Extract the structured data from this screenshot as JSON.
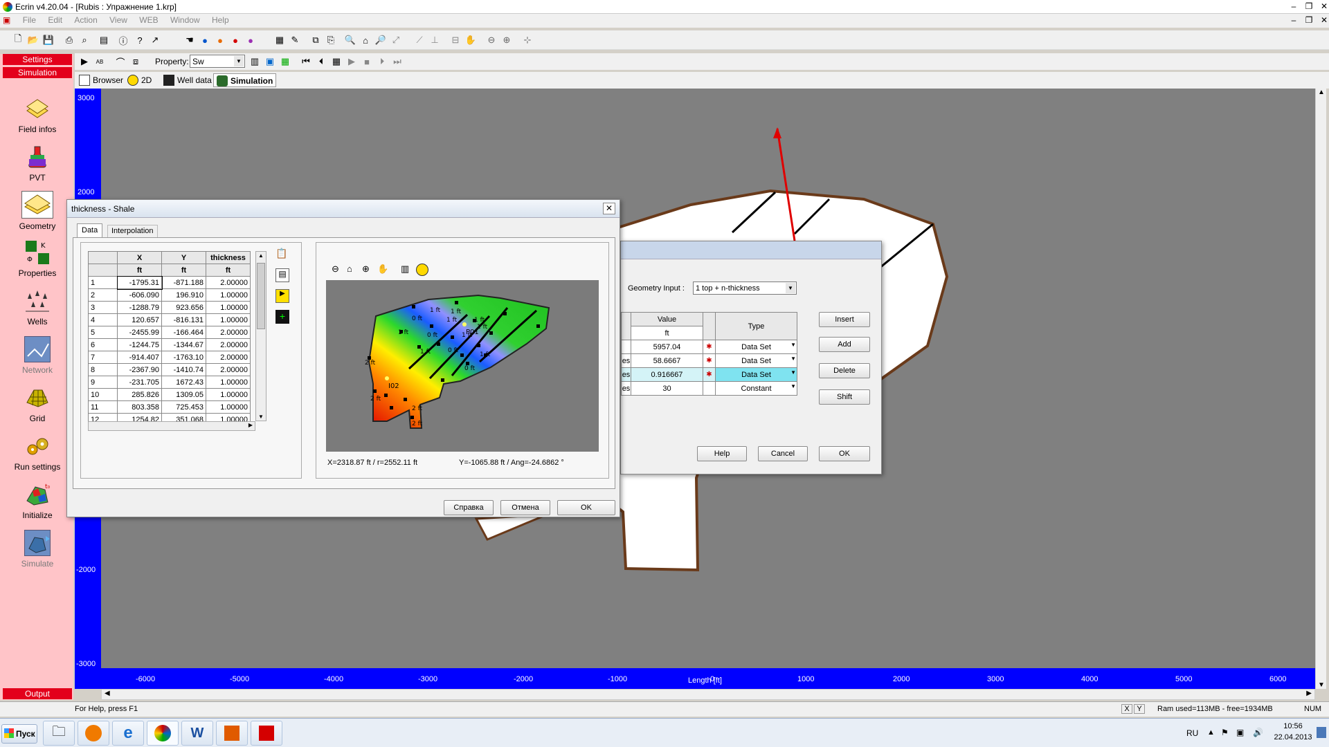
{
  "app": {
    "title": "Ecrin  v4.20.04 - [Rubis : Упражнение 1.krp]",
    "menu": [
      "File",
      "Edit",
      "Action",
      "View",
      "WEB",
      "Window",
      "Help"
    ]
  },
  "toolbar2": {
    "property_label": "Property:",
    "property_value": "Sw"
  },
  "view_tabs": [
    "Browser",
    "2D",
    "Well data",
    "Simulation"
  ],
  "sidebar": {
    "settings_label": "Settings",
    "simulation_label": "Simulation",
    "output_label": "Output",
    "items": [
      {
        "label": "Field infos",
        "icon": "field-infos-icon"
      },
      {
        "label": "PVT",
        "icon": "pvt-flask-icon"
      },
      {
        "label": "Geometry",
        "icon": "geometry-icon"
      },
      {
        "label": "Properties",
        "icon": "properties-icon"
      },
      {
        "label": "Wells",
        "icon": "wells-icon"
      },
      {
        "label": "Network",
        "icon": "network-icon"
      },
      {
        "label": "Grid",
        "icon": "grid-icon"
      },
      {
        "label": "Run settings",
        "icon": "run-settings-icon"
      },
      {
        "label": "Initialize",
        "icon": "initialize-icon"
      },
      {
        "label": "Simulate",
        "icon": "simulate-icon"
      }
    ]
  },
  "plot": {
    "x_axis_label": "Length [ft]",
    "x_ticks": [
      "-6000",
      "-5000",
      "-4000",
      "-3000",
      "-2000",
      "-1000",
      "0",
      "1000",
      "2000",
      "3000",
      "4000",
      "5000",
      "6000"
    ],
    "y_ticks": [
      "3000",
      "2000",
      "-2000",
      "-3000"
    ]
  },
  "geometry_dialog": {
    "geometry_input_label": "Geometry Input :",
    "geometry_input_value": "1 top + n-thickness",
    "col_value": "Value",
    "col_unit": "ft",
    "col_type": "Type",
    "rows": [
      {
        "value": "5957.04",
        "type": "Data Set",
        "prefix": ""
      },
      {
        "value": "58.6667",
        "type": "Data Set",
        "prefix": "es"
      },
      {
        "value": "0.916667",
        "type": "Data Set",
        "prefix": "es"
      },
      {
        "value": "30",
        "type": "Constant",
        "prefix": "es"
      }
    ],
    "btn_insert": "Insert",
    "btn_add": "Add",
    "btn_delete": "Delete",
    "btn_shift": "Shift",
    "btn_help": "Help",
    "btn_cancel": "Cancel",
    "btn_ok": "OK"
  },
  "thickness_dialog": {
    "title": "thickness - Shale",
    "tab_data": "Data",
    "tab_interp": "Interpolation",
    "headers": [
      "X",
      "Y",
      "thickness"
    ],
    "units": [
      "ft",
      "ft",
      "ft"
    ],
    "rows": [
      {
        "n": "1",
        "x": "-1795.31",
        "y": "-871.188",
        "t": "2.00000"
      },
      {
        "n": "2",
        "x": "-606.090",
        "y": "196.910",
        "t": "1.00000"
      },
      {
        "n": "3",
        "x": "-1288.79",
        "y": "923.656",
        "t": "1.00000"
      },
      {
        "n": "4",
        "x": "120.657",
        "y": "-816.131",
        "t": "1.00000"
      },
      {
        "n": "5",
        "x": "-2455.99",
        "y": "-166.464",
        "t": "2.00000"
      },
      {
        "n": "6",
        "x": "-1244.75",
        "y": "-1344.67",
        "t": "2.00000"
      },
      {
        "n": "7",
        "x": "-914.407",
        "y": "-1763.10",
        "t": "2.00000"
      },
      {
        "n": "8",
        "x": "-2367.90",
        "y": "-1410.74",
        "t": "2.00000"
      },
      {
        "n": "9",
        "x": "-231.705",
        "y": "1672.43",
        "t": "1.00000"
      },
      {
        "n": "10",
        "x": "285.826",
        "y": "1309.05",
        "t": "1.00000"
      },
      {
        "n": "11",
        "x": "803.358",
        "y": "725.453",
        "t": "1.00000"
      },
      {
        "n": "12",
        "x": "1254.82",
        "y": "351.068",
        "t": "1.00000"
      }
    ],
    "readout_x": "X=2318.87 ft / r=2552.11 ft",
    "readout_y": "Y=-1065.88 ft / Ang=-24.6862 °",
    "map_labels": [
      "1 ft",
      "1 ft",
      "1 ft",
      "1 ft",
      "1 ft",
      "1 ft",
      "1 ft",
      "1 ft",
      "0 ft",
      "0 ft",
      "0 ft",
      "0 ft",
      "1 ft",
      "2 ft",
      "2 ft",
      "2 ft",
      "2 ft",
      "P01",
      "I02"
    ],
    "btn_help": "Справка",
    "btn_cancel": "Отмена",
    "btn_ok": "OK"
  },
  "statusbar": {
    "help": "For Help, press F1",
    "x": "X",
    "y": "Y",
    "ram": "Ram used=113MB - free=1934MB",
    "num": "NUM"
  },
  "taskbar": {
    "start": "Пуск",
    "lang": "RU",
    "time": "10:56",
    "date": "22.04.2013"
  }
}
